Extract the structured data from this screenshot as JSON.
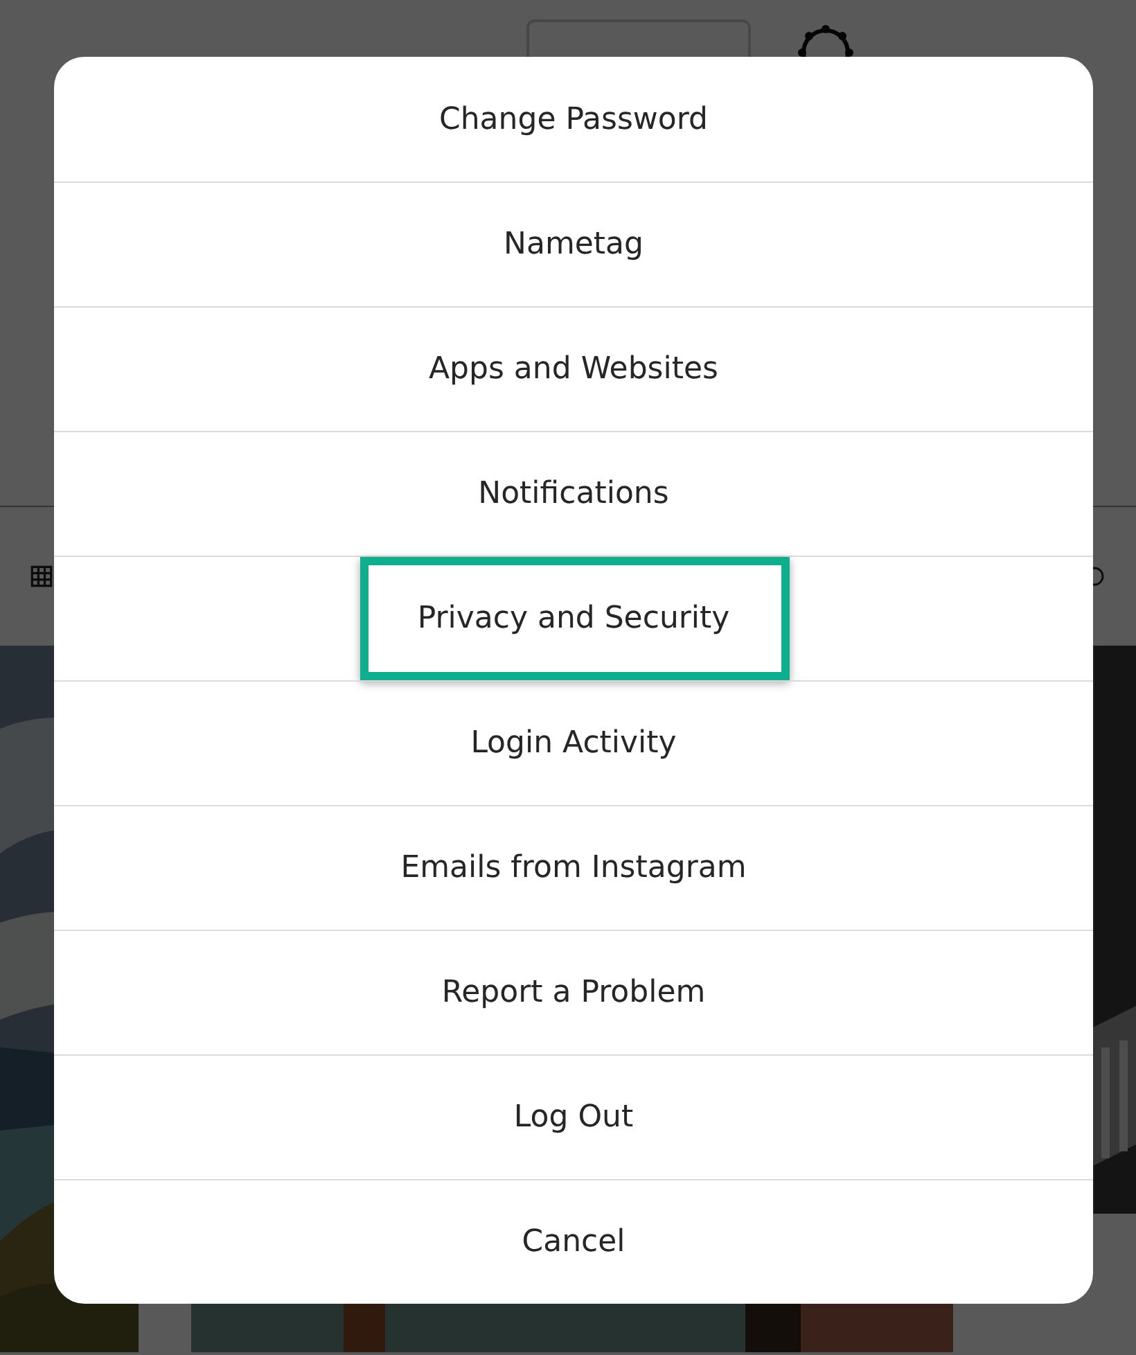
{
  "menu": {
    "items": [
      {
        "label": "Change Password",
        "highlighted": false
      },
      {
        "label": "Nametag",
        "highlighted": false
      },
      {
        "label": "Apps and Websites",
        "highlighted": false
      },
      {
        "label": "Notifications",
        "highlighted": false
      },
      {
        "label": "Privacy and Security",
        "highlighted": true
      },
      {
        "label": "Login Activity",
        "highlighted": false
      },
      {
        "label": "Emails from Instagram",
        "highlighted": false
      },
      {
        "label": "Report a Problem",
        "highlighted": false
      },
      {
        "label": "Log Out",
        "highlighted": false
      },
      {
        "label": "Cancel",
        "highlighted": false
      }
    ]
  }
}
